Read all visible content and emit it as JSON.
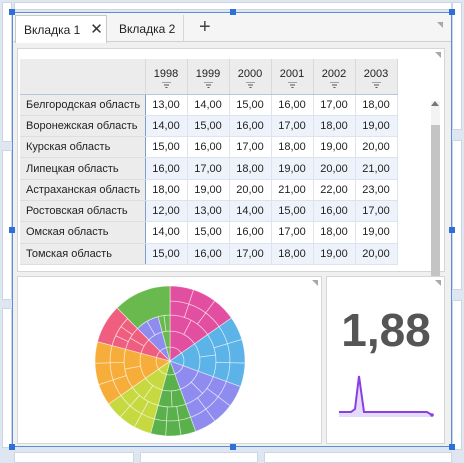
{
  "tabs": [
    {
      "label": "Вкладка 1",
      "active": true,
      "close_icon": "close-icon"
    },
    {
      "label": "Вкладка 2",
      "active": false
    }
  ],
  "add_tab_icon": "plus-icon",
  "table": {
    "filter_icon": "filter-icon",
    "columns": [
      "1998",
      "1999",
      "2000",
      "2001",
      "2002",
      "2003"
    ],
    "rows": [
      {
        "region": "Белгородская область",
        "values": [
          "13,00",
          "14,00",
          "15,00",
          "16,00",
          "17,00",
          "18,00"
        ]
      },
      {
        "region": "Воронежская область",
        "values": [
          "14,00",
          "15,00",
          "16,00",
          "17,00",
          "18,00",
          "19,00"
        ]
      },
      {
        "region": "Курская область",
        "values": [
          "15,00",
          "16,00",
          "17,00",
          "18,00",
          "19,00",
          "20,00"
        ]
      },
      {
        "region": "Липецкая область",
        "values": [
          "16,00",
          "17,00",
          "18,00",
          "19,00",
          "20,00",
          "21,00"
        ]
      },
      {
        "region": "Астраханская область",
        "values": [
          "18,00",
          "19,00",
          "20,00",
          "21,00",
          "22,00",
          "23,00"
        ]
      },
      {
        "region": "Ростовская область",
        "values": [
          "12,00",
          "13,00",
          "14,00",
          "15,00",
          "16,00",
          "17,00"
        ]
      },
      {
        "region": "Омская область",
        "values": [
          "14,00",
          "15,00",
          "16,00",
          "17,00",
          "18,00",
          "19,00"
        ]
      },
      {
        "region": "Томская область",
        "values": [
          "15,00",
          "16,00",
          "17,00",
          "18,00",
          "19,00",
          "20,00"
        ]
      }
    ]
  },
  "kpi": {
    "value": "1,88"
  },
  "colors": {
    "accent": "#2e6fd8",
    "chart_palette": [
      "#e34fa0",
      "#5bb3e8",
      "#8f8cf0",
      "#5ab04a",
      "#c7d940",
      "#f7ad3a",
      "#ef5d7f",
      "#8f8cf0",
      "#6ab94f"
    ],
    "sparkline": "#8a3fe0"
  }
}
